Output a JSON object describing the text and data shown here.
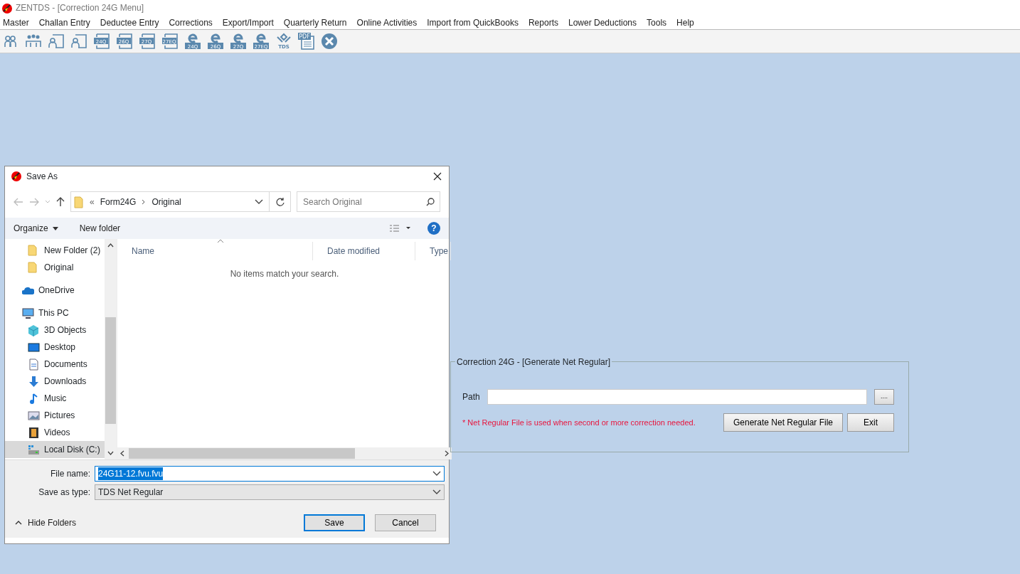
{
  "app": {
    "title": "ZENTDS - [Correction 24G Menu]"
  },
  "menu": [
    "Master",
    "Challan Entry",
    "Deductee Entry",
    "Corrections",
    "Export/Import",
    "Quarterly Return",
    "Online Activities",
    "Import from QuickBooks",
    "Reports",
    "Lower Deductions",
    "Tools",
    "Help"
  ],
  "toolbar": [
    {
      "kind": "person"
    },
    {
      "kind": "people"
    },
    {
      "kind": "person-form"
    },
    {
      "kind": "person-form"
    },
    {
      "kind": "form",
      "label": "24Q"
    },
    {
      "kind": "form",
      "label": "26Q"
    },
    {
      "kind": "form",
      "label": "27Q"
    },
    {
      "kind": "form",
      "label": "27EQ"
    },
    {
      "kind": "eform",
      "label": "24Q"
    },
    {
      "kind": "eform",
      "label": "26Q"
    },
    {
      "kind": "eform",
      "label": "27Q"
    },
    {
      "kind": "eform",
      "label": "27EQ"
    },
    {
      "kind": "tds",
      "label": "TDS"
    },
    {
      "kind": "pdf",
      "label": "PDF"
    },
    {
      "kind": "close"
    }
  ],
  "dialog": {
    "title": "Save As",
    "breadcrumb": [
      "«",
      "Form24G",
      "Original"
    ],
    "search": {
      "placeholder": "Search Original"
    },
    "commands": [
      "Organize",
      "New folder"
    ],
    "help": "?",
    "nav_tree": [
      {
        "children": [
          {
            "label": "New Folder (2)",
            "kind": "folder",
            "selected": false
          },
          {
            "label": "Original",
            "kind": "folder",
            "selected": false
          }
        ]
      },
      {
        "label": "OneDrive",
        "kind": "cloud",
        "selected": false
      },
      {
        "label": "This PC",
        "kind": "pc",
        "selected": false,
        "children": [
          {
            "label": "3D Objects",
            "kind": "cube",
            "selected": false
          },
          {
            "label": "Desktop",
            "kind": "desktop",
            "selected": false
          },
          {
            "label": "Documents",
            "kind": "doc",
            "selected": false
          },
          {
            "label": "Downloads",
            "kind": "download",
            "selected": false
          },
          {
            "label": "Music",
            "kind": "music",
            "selected": false
          },
          {
            "label": "Pictures",
            "kind": "picture",
            "selected": false
          },
          {
            "label": "Videos",
            "kind": "video",
            "selected": false
          },
          {
            "label": "Local Disk (C:)",
            "kind": "disk",
            "selected": true
          }
        ]
      }
    ],
    "columns": [
      "Name",
      "Date modified",
      "Type"
    ],
    "empty_message": "No items match your search.",
    "file_name": {
      "label": "File name:",
      "value": "24G11-12.fvu.fvu"
    },
    "save_type": {
      "label": "Save as type:",
      "value": "TDS Net Regular"
    },
    "hide_folders": "Hide Folders",
    "buttons": [
      "Save",
      "Cancel"
    ]
  },
  "panel": {
    "legend": "Correction 24G - [Generate Net Regular]",
    "path_label": "Path",
    "browse": "....",
    "note": "* Net Regular File is used when second or more correction needed.",
    "buttons": [
      "Generate Net Regular File",
      "Exit"
    ]
  }
}
